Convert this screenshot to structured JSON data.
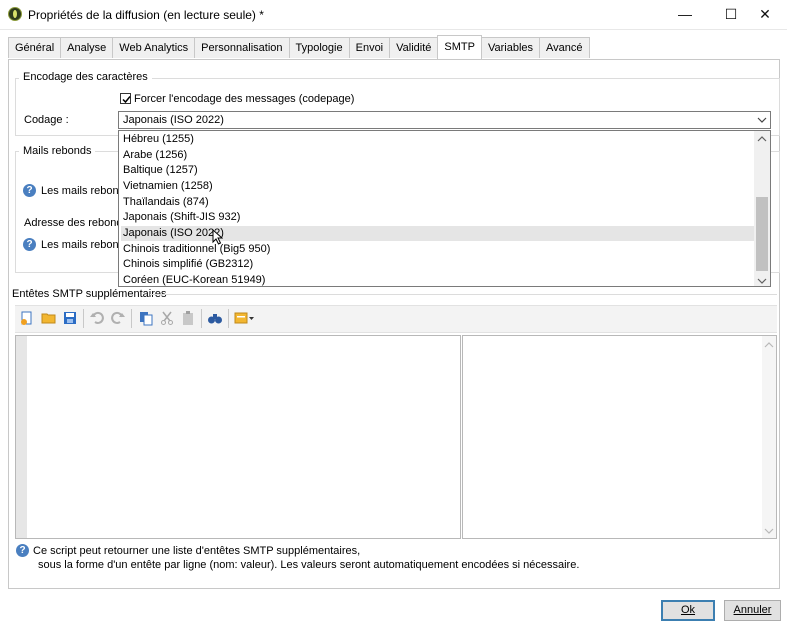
{
  "window": {
    "title": "Propriétés de la diffusion (en lecture seule) *",
    "minimize": "—",
    "maximize": "☐",
    "close": "✕"
  },
  "tabs": [
    "Général",
    "Analyse",
    "Web Analytics",
    "Personnalisation",
    "Typologie",
    "Envoi",
    "Validité",
    "SMTP",
    "Variables",
    "Avancé"
  ],
  "active_tab": "SMTP",
  "encoding": {
    "legend": "Encodage des caractères",
    "force_label": "Forcer l'encodage des messages (codepage)",
    "force_checked": true,
    "codage_label": "Codage :",
    "codage_value": "Japonais (ISO 2022)",
    "options": [
      "Hébreu (1255)",
      "Arabe (1256)",
      "Baltique (1257)",
      "Vietnamien (1258)",
      "Thaïlandais (874)",
      "Japonais (Shift-JIS 932)",
      "Japonais (ISO 2022)",
      "Chinois traditionnel (Big5 950)",
      "Chinois simplifié (GB2312)",
      "Coréen (EUC-Korean 51949)"
    ],
    "hovered_option": "Japonais (ISO 2022)"
  },
  "bounce": {
    "legend": "Mails rebonds",
    "help1": "Les mails rebonds",
    "address_label": "Adresse des rebonds :",
    "help2": "Les mails rebonds"
  },
  "smtp_headers": {
    "legend": "Entêtes SMTP supplémentaires",
    "help_line1": "Ce script peut retourner une liste d'entêtes SMTP supplémentaires,",
    "help_line2": "sous la forme d'un entête par ligne (nom: valeur). Les valeurs seront automatiquement encodées si nécessaire."
  },
  "toolbar_icons": [
    "new-icon",
    "open-folder-icon",
    "save-icon",
    "undo-icon",
    "redo-icon",
    "copy-icon",
    "cut-icon",
    "paste-icon",
    "find-icon",
    "insert-menu-icon"
  ],
  "buttons": {
    "ok": "Ok",
    "cancel": "Annuler"
  }
}
